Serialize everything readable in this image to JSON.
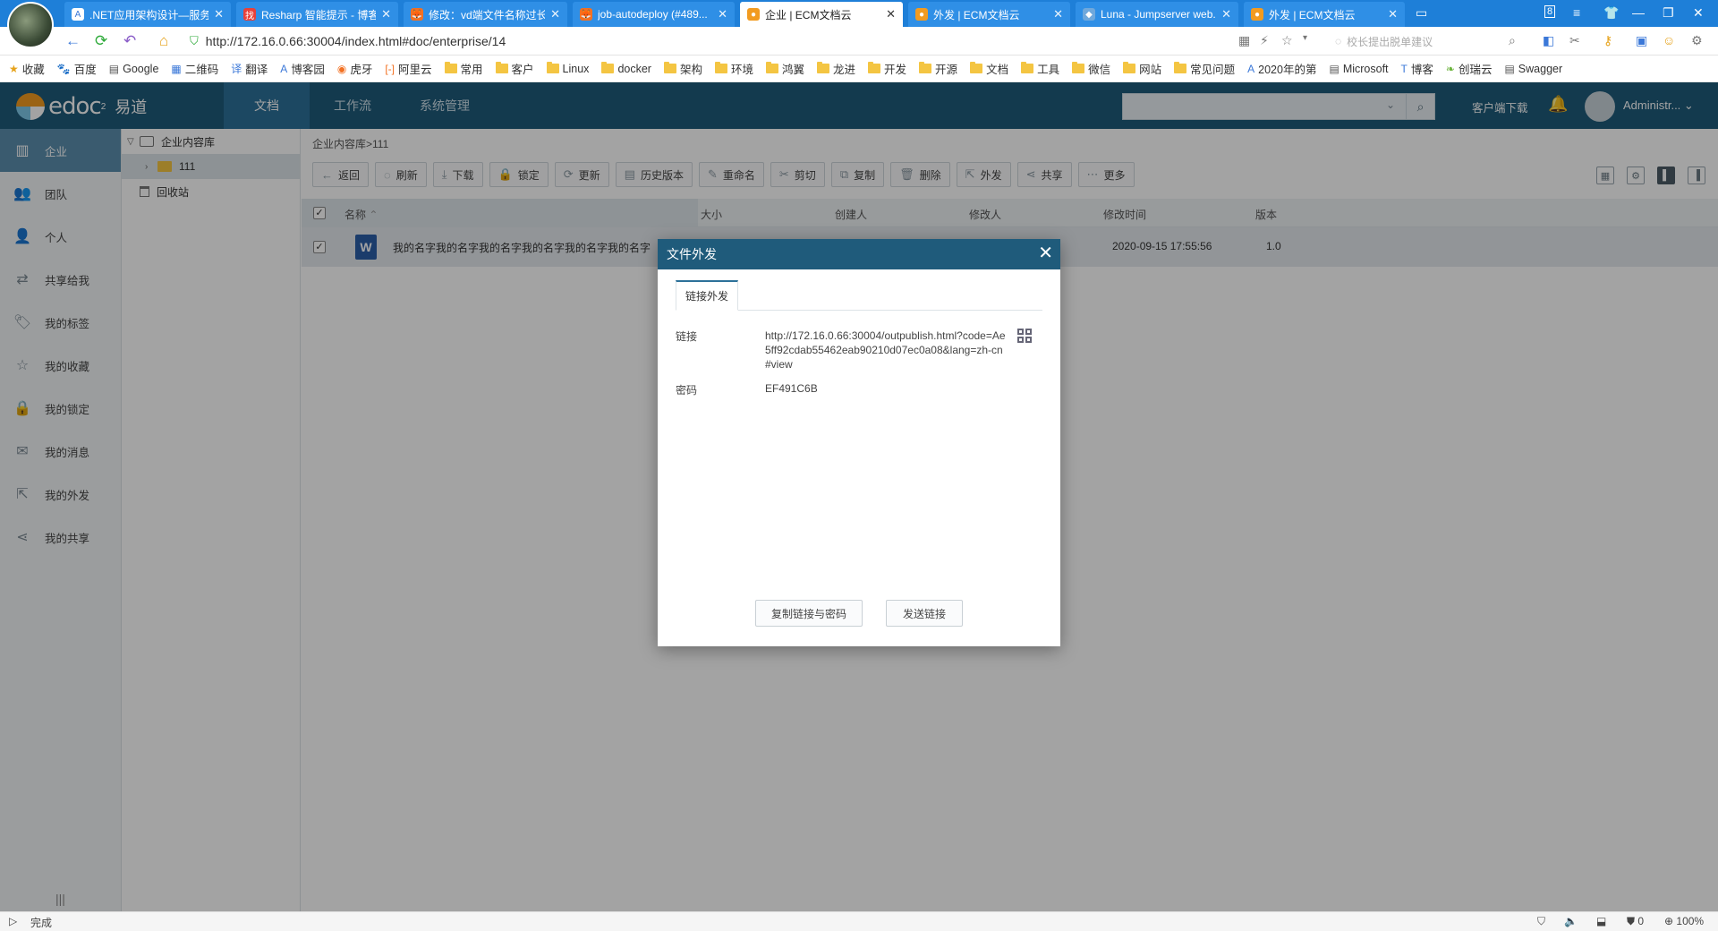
{
  "browser": {
    "tabs": [
      {
        "title": ".NET应用架构设计—服务...",
        "fav_color": "#ffffff",
        "fav_glyph": "A"
      },
      {
        "title": "Resharp 智能提示 - 博客...",
        "fav_color": "#e8413a",
        "fav_glyph": "找"
      },
      {
        "title": "修改：vd端文件名称过长...",
        "fav_color": "#f27022",
        "fav_glyph": "🦊"
      },
      {
        "title": "job-autodeploy (#489...",
        "fav_color": "#f27022",
        "fav_glyph": "🦊"
      },
      {
        "title": "企业 | ECM文档云",
        "fav_color": "#f29b20",
        "fav_glyph": "●"
      },
      {
        "title": "外发 | ECM文档云",
        "fav_color": "#f29b20",
        "fav_glyph": "●"
      },
      {
        "title": "Luna - Jumpserver web...",
        "fav_color": "#6fa8dc",
        "fav_glyph": "◆"
      },
      {
        "title": "外发 | ECM文档云",
        "fav_color": "#f29b20",
        "fav_glyph": "●"
      }
    ],
    "active_tab": 4,
    "window_controls": {
      "badge": "8"
    },
    "url": "http://172.16.0.66:30004/index.html#doc/enterprise/14",
    "search_placeholder": "校长提出脱单建议",
    "bookmarks": [
      {
        "label": "收藏",
        "icon": "star-icon"
      },
      {
        "label": "百度",
        "icon": "paw-icon"
      },
      {
        "label": "Google",
        "icon": "page-icon"
      },
      {
        "label": "二维码",
        "icon": "qr-icon"
      },
      {
        "label": "翻译",
        "icon": "translate-icon"
      },
      {
        "label": "博客园",
        "icon": "cnblogs-icon"
      },
      {
        "label": "虎牙",
        "icon": "huya-icon"
      },
      {
        "label": "阿里云",
        "icon": "aliyun-icon"
      },
      {
        "label": "常用",
        "icon": "folder-icon"
      },
      {
        "label": "客户",
        "icon": "folder-icon"
      },
      {
        "label": "Linux",
        "icon": "folder-icon"
      },
      {
        "label": "docker",
        "icon": "folder-icon"
      },
      {
        "label": "架构",
        "icon": "folder-icon"
      },
      {
        "label": "环境",
        "icon": "folder-icon"
      },
      {
        "label": "鸿翼",
        "icon": "folder-icon"
      },
      {
        "label": "龙进",
        "icon": "folder-icon"
      },
      {
        "label": "开发",
        "icon": "folder-icon"
      },
      {
        "label": "开源",
        "icon": "folder-icon"
      },
      {
        "label": "文档",
        "icon": "folder-icon"
      },
      {
        "label": "工具",
        "icon": "folder-icon"
      },
      {
        "label": "微信",
        "icon": "folder-icon"
      },
      {
        "label": "网站",
        "icon": "folder-icon"
      },
      {
        "label": "常见问题",
        "icon": "folder-icon"
      },
      {
        "label": "2020年的第",
        "icon": "cnblogs-icon"
      },
      {
        "label": "Microsoft",
        "icon": "page-icon"
      },
      {
        "label": "博客",
        "icon": "blog-icon"
      },
      {
        "label": "创瑞云",
        "icon": "leaf-icon"
      },
      {
        "label": "Swagger",
        "icon": "page-icon"
      }
    ]
  },
  "app": {
    "logo_text": "edoc",
    "logo_sup": "2",
    "logo_cn": "易道",
    "nav": [
      "文档",
      "工作流",
      "系统管理"
    ],
    "active_nav": 0,
    "client_download": "客户端下载",
    "user_name": "Administr..."
  },
  "sidebar": {
    "items": [
      {
        "label": "企业",
        "icon": "enterprise-icon",
        "active": true
      },
      {
        "label": "团队",
        "icon": "team-icon"
      },
      {
        "label": "个人",
        "icon": "person-icon"
      },
      {
        "label": "共享给我",
        "icon": "shared-to-me-icon"
      },
      {
        "label": "我的标签",
        "icon": "tag-icon"
      },
      {
        "label": "我的收藏",
        "icon": "favorite-icon"
      },
      {
        "label": "我的锁定",
        "icon": "lock-icon"
      },
      {
        "label": "我的消息",
        "icon": "mail-icon"
      },
      {
        "label": "我的外发",
        "icon": "outbound-icon"
      },
      {
        "label": "我的共享",
        "icon": "share-icon"
      }
    ]
  },
  "tree": {
    "root": "企业内容库",
    "child": "111",
    "recycle": "回收站"
  },
  "content": {
    "breadcrumb": "企业内容库>111",
    "toolbar": [
      "返回",
      "刷新",
      "下载",
      "锁定",
      "更新",
      "历史版本",
      "重命名",
      "剪切",
      "复制",
      "删除",
      "外发",
      "共享",
      "更多"
    ],
    "columns": {
      "name": "名称",
      "size": "大小",
      "creator": "创建人",
      "modifier": "修改人",
      "modified": "修改时间",
      "version": "版本"
    },
    "row": {
      "name": "我的名字我的名字我的名字我的名字我的名字我的名字",
      "modified": "2020-09-15 17:55:56",
      "version": "1.0",
      "type_glyph": "W"
    }
  },
  "modal": {
    "title": "文件外发",
    "tab": "链接外发",
    "link_label": "链接",
    "link_value": "http://172.16.0.66:30004/outpublish.html?code=Ae5ff92cdab55462eab90210d07ec0a08&lang=zh-cn#view",
    "password_label": "密码",
    "password_value": "EF491C6B",
    "copy_button": "复制链接与密码",
    "send_button": "发送链接"
  },
  "statusbar": {
    "status": "完成",
    "blocked_count": "0",
    "zoom": "100%"
  }
}
